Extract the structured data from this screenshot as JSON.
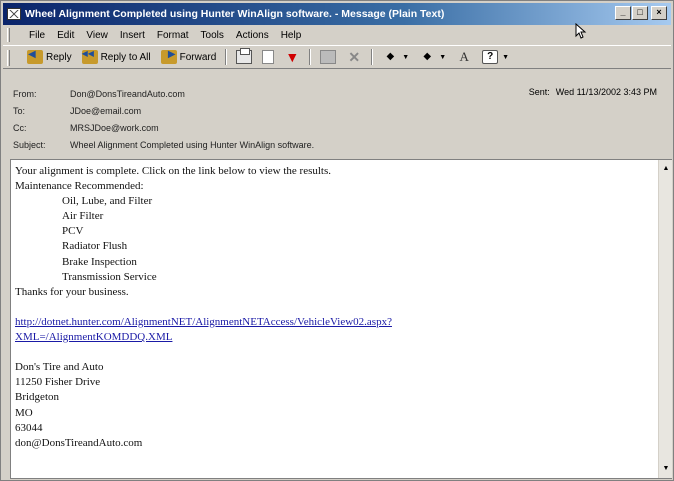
{
  "window": {
    "title": "Wheel Alignment Completed using Hunter WinAlign software. - Message (Plain Text)",
    "controls": [
      "_",
      "□",
      "×"
    ]
  },
  "menu": [
    {
      "key": "F",
      "rest": "ile"
    },
    {
      "key": "E",
      "rest": "dit"
    },
    {
      "key": "V",
      "rest": "iew"
    },
    {
      "key": "I",
      "rest": "nsert"
    },
    {
      "key": "",
      "rest": "Format",
      "underline_index": 1
    },
    {
      "key": "T",
      "rest": "ools"
    },
    {
      "key": "A",
      "rest": "ctions"
    },
    {
      "key": "H",
      "rest": "elp"
    }
  ],
  "menu_labels": {
    "file": "File",
    "edit": "Edit",
    "view": "View",
    "insert": "Insert",
    "format": "Format",
    "tools": "Tools",
    "actions": "Actions",
    "help": "Help"
  },
  "toolbar": {
    "reply": "Reply",
    "reply_all": "Reply to All",
    "forward": "Forward"
  },
  "headers": {
    "from_label": "From:",
    "from": "Don@DonsTireandAuto.com",
    "to_label": "To:",
    "to": "JDoe@email.com",
    "cc_label": "Cc:",
    "cc": "MRSJDoe@work.com",
    "subject_label": "Subject:",
    "subject": "Wheel Alignment Completed using Hunter WinAlign software.",
    "sent_label": "Sent:",
    "sent": "Wed 11/13/2002 3:43 PM"
  },
  "body": {
    "intro": "Your alignment is complete.  Click on the link below to view the results.",
    "maintenance_heading": "Maintenance Recommended:",
    "maintenance_items": [
      "Oil, Lube, and Filter",
      "Air Filter",
      "PCV",
      "Radiator Flush",
      "Brake Inspection",
      "Transmission Service"
    ],
    "thanks": "Thanks for your business.",
    "link_line1": "http://dotnet.hunter.com/AlignmentNET/AlignmentNETAccess/VehicleView02.aspx?",
    "link_line2": "XML=/AlignmentKOMDDQ.XML",
    "signature": [
      "Don's Tire and Auto",
      "11250 Fisher Drive",
      "Bridgeton",
      "MO",
      "63044",
      "don@DonsTireandAuto.com"
    ]
  }
}
